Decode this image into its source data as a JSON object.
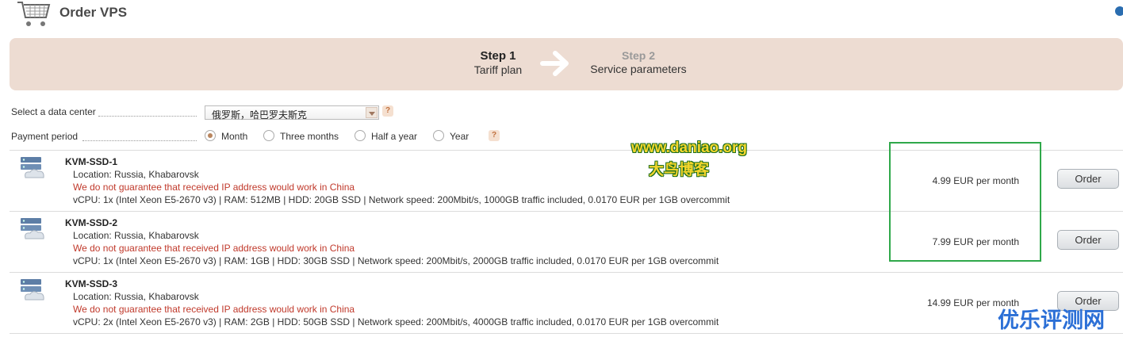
{
  "header": {
    "title": "Order VPS",
    "cart_icon": "cart-icon",
    "corner_icon": "refresh-icon"
  },
  "steps": [
    {
      "title": "Step 1",
      "subtitle": "Tariff plan"
    },
    {
      "title": "Step 2",
      "subtitle": "Service parameters"
    }
  ],
  "form": {
    "datacenter_label": "Select a data center",
    "datacenter_value": "俄罗斯，哈巴罗夫斯克",
    "payment_label": "Payment period",
    "payment_options": [
      "Month",
      "Three months",
      "Half a year",
      "Year"
    ],
    "payment_selected": "Month",
    "help": "?"
  },
  "tariffs": [
    {
      "name": "KVM-SSD-1",
      "location": "Location: Russia, Khabarovsk",
      "warning": "We do not guarantee that received IP address would work in China",
      "specs": "vCPU: 1x (Intel Xeon E5-2670 v3) | RAM: 512MB | HDD: 20GB SSD | Network speed: 200Mbit/s, 1000GB traffic included, 0.0170 EUR per 1GB overcommit",
      "price": "4.99 EUR per month",
      "order": "Order"
    },
    {
      "name": "KVM-SSD-2",
      "location": "Location: Russia, Khabarovsk",
      "warning": "We do not guarantee that received IP address would work in China",
      "specs": "vCPU: 1x (Intel Xeon E5-2670 v3) | RAM: 1GB | HDD: 30GB SSD | Network speed: 200Mbit/s, 2000GB traffic included, 0.0170 EUR per 1GB overcommit",
      "price": "7.99 EUR per month",
      "order": "Order"
    },
    {
      "name": "KVM-SSD-3",
      "location": "Location: Russia, Khabarovsk",
      "warning": "We do not guarantee that received IP address would work in China",
      "specs": "vCPU: 2x (Intel Xeon E5-2670 v3) | RAM: 2GB | HDD: 50GB SSD | Network speed: 200Mbit/s, 4000GB traffic included, 0.0170 EUR per 1GB overcommit",
      "price": "14.99 EUR per month",
      "order": "Order"
    }
  ],
  "watermarks": {
    "site": "www.daniao.org",
    "site_cn": "大鸟博客",
    "corner": "优乐评测网"
  },
  "colors": {
    "banner": "#eddcd2",
    "warning": "#c0392b",
    "highlight_box": "#2fa84a",
    "radio_selected": "#b9865f"
  }
}
